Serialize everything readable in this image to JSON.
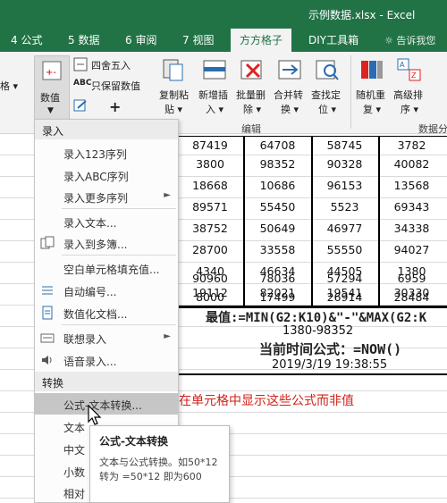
{
  "window": {
    "title": "示例数据.xlsx - Excel"
  },
  "ribbon_tabs": [
    {
      "label": "4 公式"
    },
    {
      "label": "5 数据"
    },
    {
      "label": "6 审阅"
    },
    {
      "label": "7 视图"
    },
    {
      "label": "方方格子",
      "active": true
    },
    {
      "label": "DIY工具箱"
    }
  ],
  "tell_me": "告诉我您",
  "ribbon": {
    "left_cut": "格 ▾",
    "numeric_button": "数值",
    "round_label": "四舍五入",
    "keep_value_label": "只保留数值",
    "copy_paste": [
      "复制粘",
      "贴 ▾"
    ],
    "insert_new": [
      "新增插",
      "入 ▾"
    ],
    "batch_delete": [
      "批量删",
      "除 ▾"
    ],
    "merge_convert": [
      "合并转",
      "换 ▾"
    ],
    "find_locate": [
      "查找定",
      "位 ▾"
    ],
    "random_repeat": [
      "随机重",
      "复 ▾"
    ],
    "advanced_sort": [
      "高级排",
      "序 ▾"
    ],
    "group_edit": "编辑",
    "group_data_analysis": "数据分"
  },
  "menu": {
    "section_input": "录入",
    "items_input": [
      {
        "label": "录入123序列"
      },
      {
        "label": "录入ABC序列"
      },
      {
        "label": "录入更多序列",
        "submenu": true
      },
      {
        "label": "录入文本..."
      },
      {
        "label": "录入到多簿..."
      },
      {
        "label": "空白单元格填充值..."
      },
      {
        "label": "自动编号..."
      },
      {
        "label": "数值化文档..."
      },
      {
        "label": "联想录入",
        "submenu": true
      },
      {
        "label": "语音录入..."
      }
    ],
    "section_convert": "转换",
    "items_convert": [
      {
        "label": "公式-文本转换...",
        "highlighted": true
      },
      {
        "label": "文本"
      },
      {
        "label": "中文"
      },
      {
        "label": "小数"
      },
      {
        "label": "相对"
      }
    ]
  },
  "tooltip": {
    "title": "公式-文本转换",
    "body": "文本与公式转换。如50*12 转为 =50*12 即为600"
  },
  "table": {
    "rows": [
      [
        "87419",
        "64708",
        "58745",
        "3782"
      ],
      [
        "3800",
        "98352",
        "90328",
        "40082"
      ],
      [
        "18668",
        "10686",
        "96153",
        "13568"
      ],
      [
        "89571",
        "55450",
        "5523",
        "69343"
      ],
      [
        "38752",
        "50649",
        "46977",
        "34338"
      ],
      [
        "28700",
        "33558",
        "55550",
        "94027"
      ],
      [
        "4340",
        "46634",
        "44505",
        "1380"
      ],
      [
        "19112",
        "82021",
        "19541",
        "30330"
      ],
      [
        "90960",
        "78036",
        "57294",
        "6959"
      ],
      [
        "8000",
        "17499",
        "26914",
        "28484"
      ]
    ],
    "formula_max_min": "最值:=MIN(G2:K10)&\"-\"&MAX(G2:K",
    "range_result": "1380-98352",
    "now_formula": "当前时间公式：=NOW()",
    "now_result": "2019/3/19  19:38:55"
  },
  "note_red": "在单元格中显示这些公式而非值",
  "colors": {
    "excel_green": "#217346",
    "highlight": "#c6c6c6",
    "note": "#d0211a"
  }
}
